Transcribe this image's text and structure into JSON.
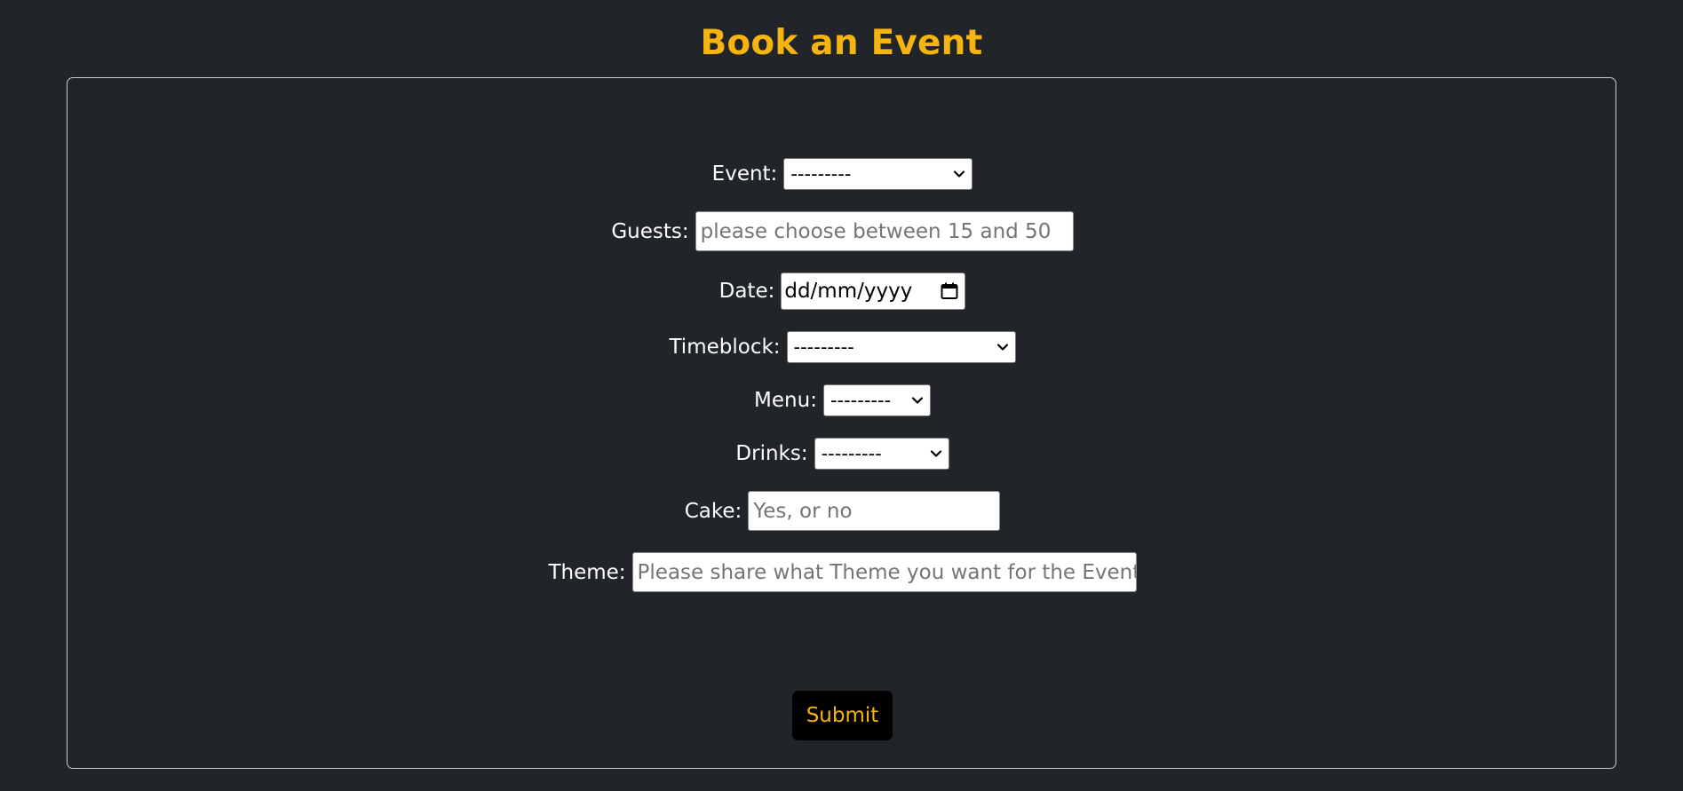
{
  "header": {
    "title": "Book an Event"
  },
  "form": {
    "event": {
      "label": "Event:",
      "value": "---------"
    },
    "guests": {
      "label": "Guests:",
      "placeholder": "please choose between 15 and 50"
    },
    "date": {
      "label": "Date:",
      "value": "dd/mm/yyyy"
    },
    "timeblock": {
      "label": "Timeblock:",
      "value": "---------"
    },
    "menu": {
      "label": "Menu:",
      "value": "---------"
    },
    "drinks": {
      "label": "Drinks:",
      "value": "---------"
    },
    "cake": {
      "label": "Cake:",
      "placeholder": "Yes, or no"
    },
    "theme": {
      "label": "Theme:",
      "placeholder": "Please share what Theme you want for the Event e,g."
    },
    "submit_label": "Submit"
  },
  "colors": {
    "background": "#212429",
    "accent": "#f5b40f",
    "border": "#c9ccd1"
  },
  "icons": {
    "dropdown": "chevron-down-icon",
    "date_picker": "calendar-icon"
  }
}
